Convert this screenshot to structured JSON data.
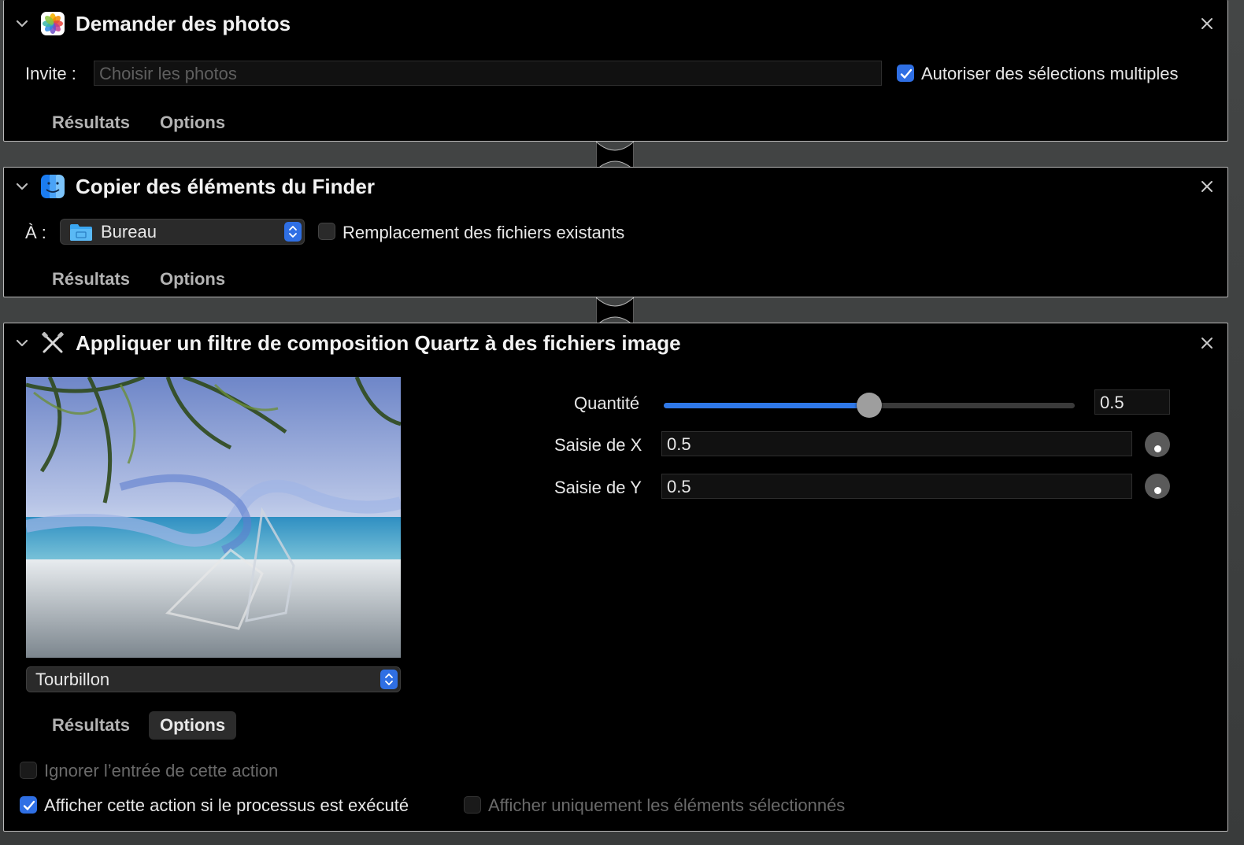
{
  "actions": [
    {
      "title": "Demander des photos",
      "icon": "photos-icon",
      "prompt_label": "Invite :",
      "prompt_placeholder": "Choisir les photos",
      "allow_multiple_label": "Autoriser des sélections multiples",
      "allow_multiple_checked": true,
      "tabs": [
        "Résultats",
        "Options"
      ]
    },
    {
      "title": "Copier des éléments du Finder",
      "icon": "finder-icon",
      "to_label": "À :",
      "destination": "Bureau",
      "replace_label": "Remplacement des fichiers existants",
      "replace_checked": false,
      "tabs": [
        "Résultats",
        "Options"
      ]
    },
    {
      "title": "Appliquer un filtre de composition Quartz à des fichiers image",
      "icon": "quartz-tools-icon",
      "filter": "Tourbillon",
      "params": {
        "amount_label": "Quantité",
        "amount_value": "0.5",
        "amount_fraction": 0.5,
        "x_label": "Saisie de X",
        "x_value": "0.5",
        "y_label": "Saisie de Y",
        "y_value": "0.5"
      },
      "tabs": [
        "Résultats",
        "Options"
      ],
      "active_tab": "Options",
      "options": {
        "ignore_input_label": "Ignorer l’entrée de cette action",
        "ignore_input_checked": false,
        "show_when_run_label": "Afficher cette action si le processus est exécuté",
        "show_when_run_checked": true,
        "show_selected_only_label": "Afficher uniquement les éléments sélectionnés",
        "show_selected_only_checked": false
      }
    }
  ],
  "colors": {
    "accent": "#2f6fe4",
    "panel_bg": "#000000",
    "canvas_bg": "#3b3d3d"
  }
}
